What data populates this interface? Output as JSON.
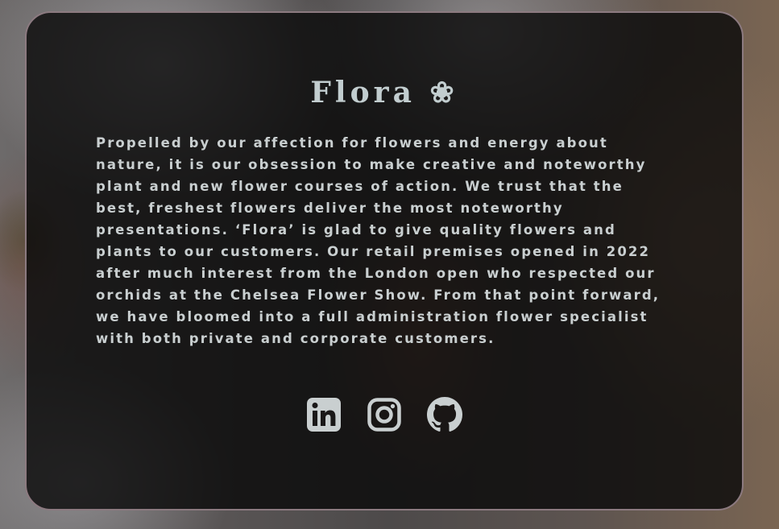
{
  "about": {
    "title": "Flora ❀",
    "description": "Propelled by our affection for flowers and energy about nature, it is our obsession to make creative and noteworthy plant and new flower courses of action. We trust that the best, freshest flowers deliver the most noteworthy presentations. ‘Flora’ is glad to give quality flowers and plants to our customers. Our retail premises opened in 2022 after much interest from the London open who respected our orchids at the Chelsea Flower Show. From that point forward, we have bloomed into a full administration flower specialist with both private and corporate customers."
  },
  "socials": [
    {
      "icon": "linkedin-icon"
    },
    {
      "icon": "instagram-icon"
    },
    {
      "icon": "github-icon"
    }
  ],
  "colors": {
    "text": "#c9cfd0",
    "card_border": "#8c7a80",
    "card_background": "#080707"
  }
}
